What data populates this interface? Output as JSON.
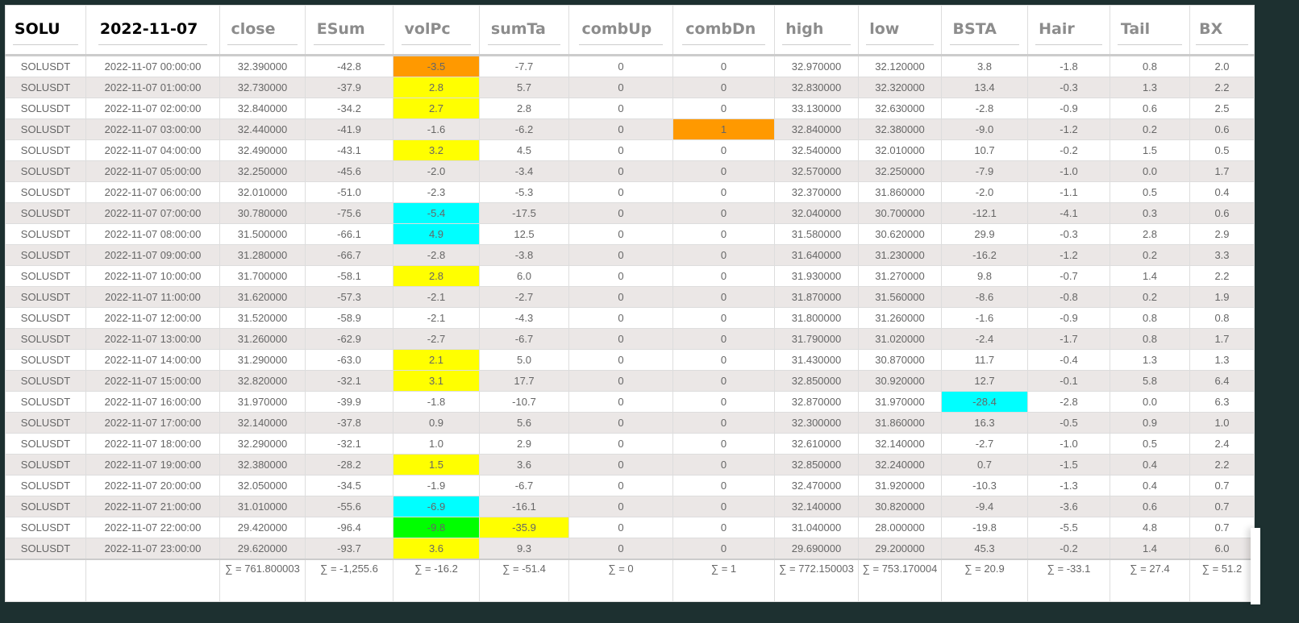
{
  "columns": [
    {
      "key": "symbol",
      "value": "SOLU",
      "placeholder": ""
    },
    {
      "key": "time",
      "value": "2022-11-07",
      "placeholder": ""
    },
    {
      "key": "close",
      "value": "",
      "placeholder": "close"
    },
    {
      "key": "ESum",
      "value": "",
      "placeholder": "ESum"
    },
    {
      "key": "volPc",
      "value": "",
      "placeholder": "volPc"
    },
    {
      "key": "sumTa",
      "value": "",
      "placeholder": "sumTa"
    },
    {
      "key": "combUp",
      "value": "",
      "placeholder": "combUp"
    },
    {
      "key": "combDn",
      "value": "",
      "placeholder": "combDn"
    },
    {
      "key": "high",
      "value": "",
      "placeholder": "high"
    },
    {
      "key": "low",
      "value": "",
      "placeholder": "low"
    },
    {
      "key": "BSTA",
      "value": "",
      "placeholder": "BSTA"
    },
    {
      "key": "Hair",
      "value": "",
      "placeholder": "Hair"
    },
    {
      "key": "Tail",
      "value": "",
      "placeholder": "Tail"
    },
    {
      "key": "BX",
      "value": "",
      "placeholder": "BX"
    }
  ],
  "colors": {
    "orange": "#ff9900",
    "yellow": "#ffff00",
    "cyan": "#00ffff",
    "green": "#00ff00"
  },
  "rows": [
    [
      "SOLUSDT",
      "2022-11-07 00:00:00",
      "32.390000",
      "-42.8",
      "-3.5",
      "-7.7",
      "0",
      "0",
      "32.970000",
      "32.120000",
      "3.8",
      "-1.8",
      "0.8",
      "2.0"
    ],
    [
      "SOLUSDT",
      "2022-11-07 01:00:00",
      "32.730000",
      "-37.9",
      "2.8",
      "5.7",
      "0",
      "0",
      "32.830000",
      "32.320000",
      "13.4",
      "-0.3",
      "1.3",
      "2.2"
    ],
    [
      "SOLUSDT",
      "2022-11-07 02:00:00",
      "32.840000",
      "-34.2",
      "2.7",
      "2.8",
      "0",
      "0",
      "33.130000",
      "32.630000",
      "-2.8",
      "-0.9",
      "0.6",
      "2.5"
    ],
    [
      "SOLUSDT",
      "2022-11-07 03:00:00",
      "32.440000",
      "-41.9",
      "-1.6",
      "-6.2",
      "0",
      "1",
      "32.840000",
      "32.380000",
      "-9.0",
      "-1.2",
      "0.2",
      "0.6"
    ],
    [
      "SOLUSDT",
      "2022-11-07 04:00:00",
      "32.490000",
      "-43.1",
      "3.2",
      "4.5",
      "0",
      "0",
      "32.540000",
      "32.010000",
      "10.7",
      "-0.2",
      "1.5",
      "0.5"
    ],
    [
      "SOLUSDT",
      "2022-11-07 05:00:00",
      "32.250000",
      "-45.6",
      "-2.0",
      "-3.4",
      "0",
      "0",
      "32.570000",
      "32.250000",
      "-7.9",
      "-1.0",
      "0.0",
      "1.7"
    ],
    [
      "SOLUSDT",
      "2022-11-07 06:00:00",
      "32.010000",
      "-51.0",
      "-2.3",
      "-5.3",
      "0",
      "0",
      "32.370000",
      "31.860000",
      "-2.0",
      "-1.1",
      "0.5",
      "0.4"
    ],
    [
      "SOLUSDT",
      "2022-11-07 07:00:00",
      "30.780000",
      "-75.6",
      "-5.4",
      "-17.5",
      "0",
      "0",
      "32.040000",
      "30.700000",
      "-12.1",
      "-4.1",
      "0.3",
      "0.6"
    ],
    [
      "SOLUSDT",
      "2022-11-07 08:00:00",
      "31.500000",
      "-66.1",
      "4.9",
      "12.5",
      "0",
      "0",
      "31.580000",
      "30.620000",
      "29.9",
      "-0.3",
      "2.8",
      "2.9"
    ],
    [
      "SOLUSDT",
      "2022-11-07 09:00:00",
      "31.280000",
      "-66.7",
      "-2.8",
      "-3.8",
      "0",
      "0",
      "31.640000",
      "31.230000",
      "-16.2",
      "-1.2",
      "0.2",
      "3.3"
    ],
    [
      "SOLUSDT",
      "2022-11-07 10:00:00",
      "31.700000",
      "-58.1",
      "2.8",
      "6.0",
      "0",
      "0",
      "31.930000",
      "31.270000",
      "9.8",
      "-0.7",
      "1.4",
      "2.2"
    ],
    [
      "SOLUSDT",
      "2022-11-07 11:00:00",
      "31.620000",
      "-57.3",
      "-2.1",
      "-2.7",
      "0",
      "0",
      "31.870000",
      "31.560000",
      "-8.6",
      "-0.8",
      "0.2",
      "1.9"
    ],
    [
      "SOLUSDT",
      "2022-11-07 12:00:00",
      "31.520000",
      "-58.9",
      "-2.1",
      "-4.3",
      "0",
      "0",
      "31.800000",
      "31.260000",
      "-1.6",
      "-0.9",
      "0.8",
      "0.8"
    ],
    [
      "SOLUSDT",
      "2022-11-07 13:00:00",
      "31.260000",
      "-62.9",
      "-2.7",
      "-6.7",
      "0",
      "0",
      "31.790000",
      "31.020000",
      "-2.4",
      "-1.7",
      "0.8",
      "1.7"
    ],
    [
      "SOLUSDT",
      "2022-11-07 14:00:00",
      "31.290000",
      "-63.0",
      "2.1",
      "5.0",
      "0",
      "0",
      "31.430000",
      "30.870000",
      "11.7",
      "-0.4",
      "1.3",
      "1.3"
    ],
    [
      "SOLUSDT",
      "2022-11-07 15:00:00",
      "32.820000",
      "-32.1",
      "3.1",
      "17.7",
      "0",
      "0",
      "32.850000",
      "30.920000",
      "12.7",
      "-0.1",
      "5.8",
      "6.4"
    ],
    [
      "SOLUSDT",
      "2022-11-07 16:00:00",
      "31.970000",
      "-39.9",
      "-1.8",
      "-10.7",
      "0",
      "0",
      "32.870000",
      "31.970000",
      "-28.4",
      "-2.8",
      "0.0",
      "6.3"
    ],
    [
      "SOLUSDT",
      "2022-11-07 17:00:00",
      "32.140000",
      "-37.8",
      "0.9",
      "5.6",
      "0",
      "0",
      "32.300000",
      "31.860000",
      "16.3",
      "-0.5",
      "0.9",
      "1.0"
    ],
    [
      "SOLUSDT",
      "2022-11-07 18:00:00",
      "32.290000",
      "-32.1",
      "1.0",
      "2.9",
      "0",
      "0",
      "32.610000",
      "32.140000",
      "-2.7",
      "-1.0",
      "0.5",
      "2.4"
    ],
    [
      "SOLUSDT",
      "2022-11-07 19:00:00",
      "32.380000",
      "-28.2",
      "1.5",
      "3.6",
      "0",
      "0",
      "32.850000",
      "32.240000",
      "0.7",
      "-1.5",
      "0.4",
      "2.2"
    ],
    [
      "SOLUSDT",
      "2022-11-07 20:00:00",
      "32.050000",
      "-34.5",
      "-1.9",
      "-6.7",
      "0",
      "0",
      "32.470000",
      "31.920000",
      "-10.3",
      "-1.3",
      "0.4",
      "0.7"
    ],
    [
      "SOLUSDT",
      "2022-11-07 21:00:00",
      "31.010000",
      "-55.6",
      "-6.9",
      "-16.1",
      "0",
      "0",
      "32.140000",
      "30.820000",
      "-9.4",
      "-3.6",
      "0.6",
      "0.7"
    ],
    [
      "SOLUSDT",
      "2022-11-07 22:00:00",
      "29.420000",
      "-96.4",
      "-9.8",
      "-35.9",
      "0",
      "0",
      "31.040000",
      "28.000000",
      "-19.8",
      "-5.5",
      "4.8",
      "0.7"
    ],
    [
      "SOLUSDT",
      "2022-11-07 23:00:00",
      "29.620000",
      "-93.7",
      "3.6",
      "9.3",
      "0",
      "0",
      "29.690000",
      "29.200000",
      "45.3",
      "-0.2",
      "1.4",
      "6.0"
    ]
  ],
  "highlights": [
    {
      "row": 0,
      "col": 4,
      "color": "orange"
    },
    {
      "row": 1,
      "col": 4,
      "color": "yellow"
    },
    {
      "row": 2,
      "col": 4,
      "color": "yellow"
    },
    {
      "row": 3,
      "col": 7,
      "color": "orange"
    },
    {
      "row": 4,
      "col": 4,
      "color": "yellow"
    },
    {
      "row": 7,
      "col": 4,
      "color": "cyan"
    },
    {
      "row": 8,
      "col": 4,
      "color": "cyan"
    },
    {
      "row": 10,
      "col": 4,
      "color": "yellow"
    },
    {
      "row": 14,
      "col": 4,
      "color": "yellow"
    },
    {
      "row": 15,
      "col": 4,
      "color": "yellow"
    },
    {
      "row": 16,
      "col": 10,
      "color": "cyan"
    },
    {
      "row": 19,
      "col": 4,
      "color": "yellow"
    },
    {
      "row": 21,
      "col": 4,
      "color": "cyan"
    },
    {
      "row": 22,
      "col": 4,
      "color": "green"
    },
    {
      "row": 22,
      "col": 5,
      "color": "yellow"
    },
    {
      "row": 23,
      "col": 4,
      "color": "yellow"
    }
  ],
  "totals": [
    "",
    "",
    "∑ = 761.800003",
    "∑ = -1,255.6",
    "∑ = -16.2",
    "∑ = -51.4",
    "∑ = 0",
    "∑ = 1",
    "∑ = 772.150003",
    "∑ = 753.170004",
    "∑ = 20.9",
    "∑ = -33.1",
    "∑ = 27.4",
    "∑ = 51.2"
  ]
}
